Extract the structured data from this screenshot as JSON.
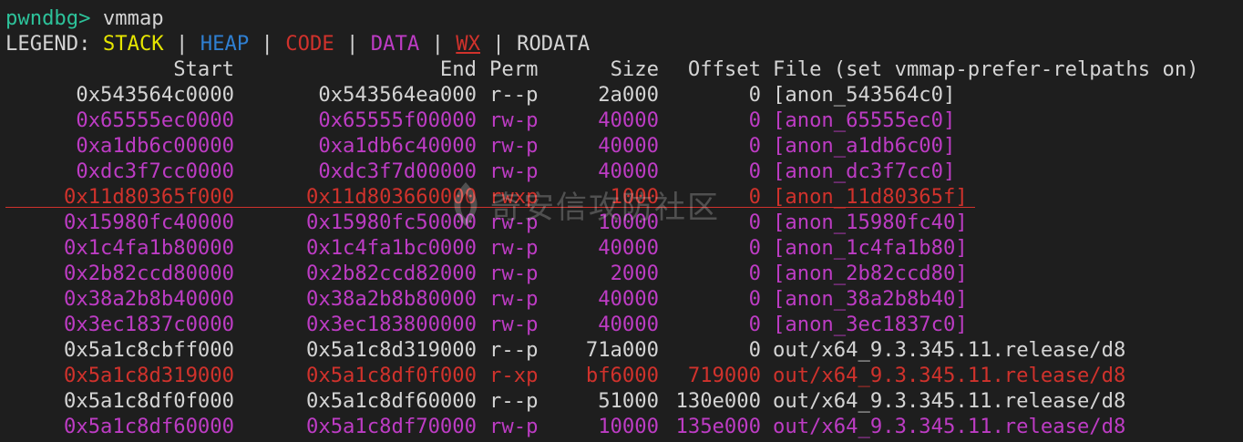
{
  "prompt": {
    "name": "pwndbg>",
    "command": " vmmap"
  },
  "legend": {
    "label": "LEGEND: ",
    "sep": " | ",
    "stack": "STACK",
    "heap": "HEAP",
    "code": "CODE",
    "data": "DATA",
    "wx": "WX",
    "rodata": "RODATA"
  },
  "header": {
    "start": "Start",
    "end": "End",
    "perm": "Perm",
    "size": "Size",
    "offset": "Offset",
    "file": "File (set vmmap-prefer-relpaths on)"
  },
  "rows": [
    {
      "start": "0x543564c0000",
      "end": "0x543564ea000",
      "perm": "r--p",
      "size": "2a000",
      "offset": "0",
      "file": "[anon_543564c0]",
      "kind": "rodata"
    },
    {
      "start": "0x65555ec0000",
      "end": "0x65555f00000",
      "perm": "rw-p",
      "size": "40000",
      "offset": "0",
      "file": "[anon_65555ec0]",
      "kind": "data"
    },
    {
      "start": "0xa1db6c00000",
      "end": "0xa1db6c40000",
      "perm": "rw-p",
      "size": "40000",
      "offset": "0",
      "file": "[anon_a1db6c00]",
      "kind": "data"
    },
    {
      "start": "0xdc3f7cc0000",
      "end": "0xdc3f7d00000",
      "perm": "rw-p",
      "size": "40000",
      "offset": "0",
      "file": "[anon_dc3f7cc0]",
      "kind": "data"
    },
    {
      "start": "0x11d80365f000",
      "end": "0x11d803660000",
      "perm": "rwxp",
      "size": "1000",
      "offset": "0",
      "file": "[anon_11d80365f]",
      "kind": "wx"
    },
    {
      "start": "0x15980fc40000",
      "end": "0x15980fc50000",
      "perm": "rw-p",
      "size": "10000",
      "offset": "0",
      "file": "[anon_15980fc40]",
      "kind": "data"
    },
    {
      "start": "0x1c4fa1b80000",
      "end": "0x1c4fa1bc0000",
      "perm": "rw-p",
      "size": "40000",
      "offset": "0",
      "file": "[anon_1c4fa1b80]",
      "kind": "data"
    },
    {
      "start": "0x2b82ccd80000",
      "end": "0x2b82ccd82000",
      "perm": "rw-p",
      "size": "2000",
      "offset": "0",
      "file": "[anon_2b82ccd80]",
      "kind": "data"
    },
    {
      "start": "0x38a2b8b40000",
      "end": "0x38a2b8b80000",
      "perm": "rw-p",
      "size": "40000",
      "offset": "0",
      "file": "[anon_38a2b8b40]",
      "kind": "data"
    },
    {
      "start": "0x3ec1837c0000",
      "end": "0x3ec183800000",
      "perm": "rw-p",
      "size": "40000",
      "offset": "0",
      "file": "[anon_3ec1837c0]",
      "kind": "data"
    },
    {
      "start": "0x5a1c8cbff000",
      "end": "0x5a1c8d319000",
      "perm": "r--p",
      "size": "71a000",
      "offset": "0",
      "file": "out/x64_9.3.345.11.release/d8",
      "kind": "rodata"
    },
    {
      "start": "0x5a1c8d319000",
      "end": "0x5a1c8df0f000",
      "perm": "r-xp",
      "size": "bf6000",
      "offset": "719000",
      "file": "out/x64_9.3.345.11.release/d8",
      "kind": "code"
    },
    {
      "start": "0x5a1c8df0f000",
      "end": "0x5a1c8df60000",
      "perm": "r--p",
      "size": "51000",
      "offset": "130e000",
      "file": "out/x64_9.3.345.11.release/d8",
      "kind": "rodata"
    },
    {
      "start": "0x5a1c8df60000",
      "end": "0x5a1c8df70000",
      "perm": "rw-p",
      "size": "10000",
      "offset": "135e000",
      "file": "out/x64_9.3.345.11.release/d8",
      "kind": "data"
    }
  ],
  "colors": {
    "stack": "#e6e600",
    "heap": "#2f7fd1",
    "code": "#d0322c",
    "data": "#bd3cc4",
    "wx": "#d0322c",
    "rodata": "#d4d4d4",
    "prompt": "#2dc29a"
  },
  "watermark": {
    "text": "奇安信攻防社区",
    "icon": "qianxin-logo-icon"
  }
}
